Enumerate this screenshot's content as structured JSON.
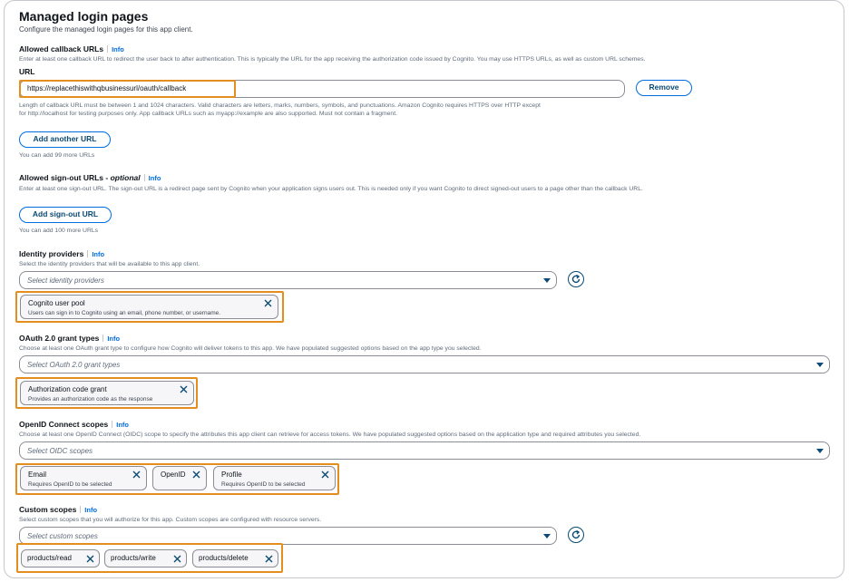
{
  "header": {
    "title": "Managed login pages",
    "subtitle": "Configure the managed login pages for this app client."
  },
  "info_label": "Info",
  "callback": {
    "label": "Allowed callback URLs",
    "description": "Enter at least one callback URL to redirect the user back to after authentication. This is typically the URL for the app receiving the authorization code issued by Cognito. You may use HTTPS URLs, as well as custom URL schemes.",
    "url_label": "URL",
    "url_value": "https://replacethiswithqbusinessurl/oauth/callback",
    "remove_label": "Remove",
    "hint_line1": "Length of callback URL must be between 1 and 1024 characters. Valid characters are letters, marks, numbers, symbols, and punctuations. Amazon Cognito requires HTTPS over HTTP except",
    "hint_line2": "for http://localhost for testing purposes only. App callback URLs such as myapp://example are also supported. Must not contain a fragment.",
    "add_label": "Add another URL",
    "remaining": "You can add 99 more URLs"
  },
  "signout": {
    "label": "Allowed sign-out URLs -",
    "optional": "optional",
    "description": "Enter at least one sign-out URL. The sign-out URL is a redirect page sent by Cognito when your application signs users out. This is needed only if you want Cognito to direct signed-out users to a page other than the callback URL.",
    "add_label": "Add sign-out URL",
    "remaining": "You can add 100 more URLs"
  },
  "identity": {
    "label": "Identity providers",
    "description": "Select the identity providers that will be available to this app client.",
    "placeholder": "Select identity providers",
    "tokens": [
      {
        "title": "Cognito user pool",
        "desc": "Users can sign in to Cognito using an email, phone number, or username."
      }
    ]
  },
  "grant": {
    "label": "OAuth 2.0 grant types",
    "description": "Choose at least one OAuth grant type to configure how Cognito will deliver tokens to this app. We have populated suggested options based on the app type you selected.",
    "placeholder": "Select OAuth 2.0 grant types",
    "tokens": [
      {
        "title": "Authorization code grant",
        "desc": "Provides an authorization code as the response"
      }
    ]
  },
  "oidc": {
    "label": "OpenID Connect scopes",
    "description": "Choose at least one OpenID Connect (OIDC) scope to specify the attributes this app client can retrieve for access tokens. We have populated suggested options based on the application type and required attributes you selected.",
    "placeholder": "Select OIDC scopes",
    "tokens": [
      {
        "title": "Email",
        "desc": "Requires OpenID to be selected"
      },
      {
        "title": "OpenID",
        "desc": ""
      },
      {
        "title": "Profile",
        "desc": "Requires OpenID to be selected"
      }
    ]
  },
  "custom": {
    "label": "Custom scopes",
    "description": "Select custom scopes that you will authorize for this app. Custom scopes are configured with resource servers.",
    "placeholder": "Select custom scopes",
    "tokens": [
      {
        "title": "products/read"
      },
      {
        "title": "products/write"
      },
      {
        "title": "products/delete"
      }
    ]
  },
  "colors": {
    "accent": "#006ce0",
    "highlight": "#e48e1f",
    "text": "#0f141a"
  }
}
